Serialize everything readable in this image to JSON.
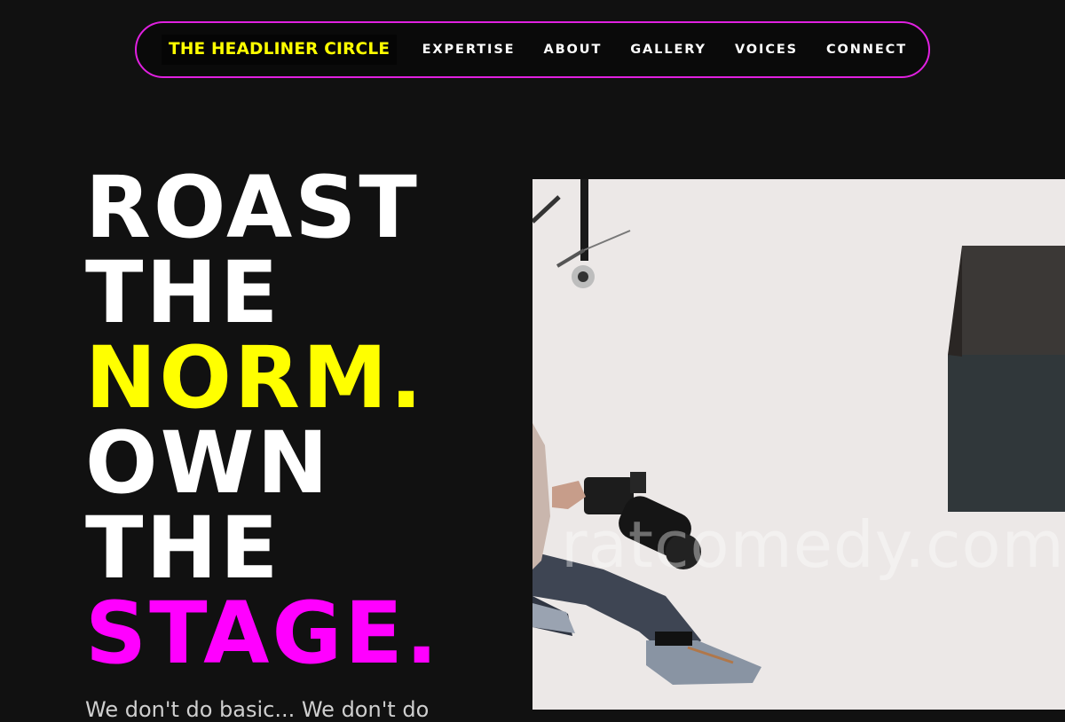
{
  "nav": {
    "brand": "THE HEADLINER CIRCLE",
    "links": [
      "EXPERTISE",
      "ABOUT",
      "GALLERY",
      "VOICES",
      "CONNECT"
    ]
  },
  "hero": {
    "line1": "ROAST",
    "line2": "THE",
    "line3": "NORM.",
    "line4": "OWN",
    "line5": "THE",
    "line6": "STAGE.",
    "subtext": "We don't do basic... We don't do"
  },
  "photo": {
    "watermark": "ratcomedy.com"
  },
  "colors": {
    "background": "#111111",
    "accent_yellow": "#ffff00",
    "accent_magenta": "#ff00ff",
    "nav_border": "#e020e0"
  }
}
